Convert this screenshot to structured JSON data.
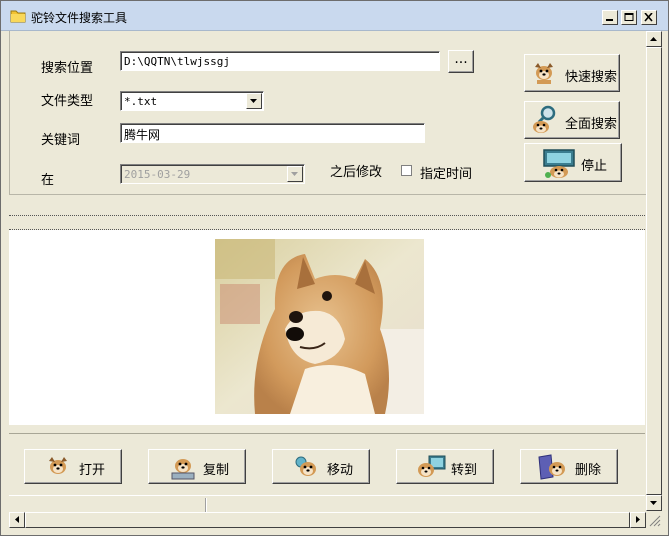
{
  "window": {
    "title": "驼铃文件搜索工具"
  },
  "search": {
    "location_label": "搜索位置",
    "location_value": "D:\\QQTN\\tlwjssgj",
    "browse_label": "...",
    "filetype_label": "文件类型",
    "filetype_value": "*.txt",
    "keyword_label": "关键词",
    "keyword_value": "腾牛网",
    "date_prefix_label": "在",
    "date_value": "2015-03-29",
    "date_suffix_label": "之后修改",
    "specify_time_label": "指定时间",
    "specify_time_checked": false
  },
  "actions": {
    "quick_search": "快速搜索",
    "full_search": "全面搜索",
    "stop": "停止"
  },
  "file_ops": {
    "open": "打开",
    "copy": "复制",
    "move": "移动",
    "goto": "转到",
    "delete": "删除"
  }
}
